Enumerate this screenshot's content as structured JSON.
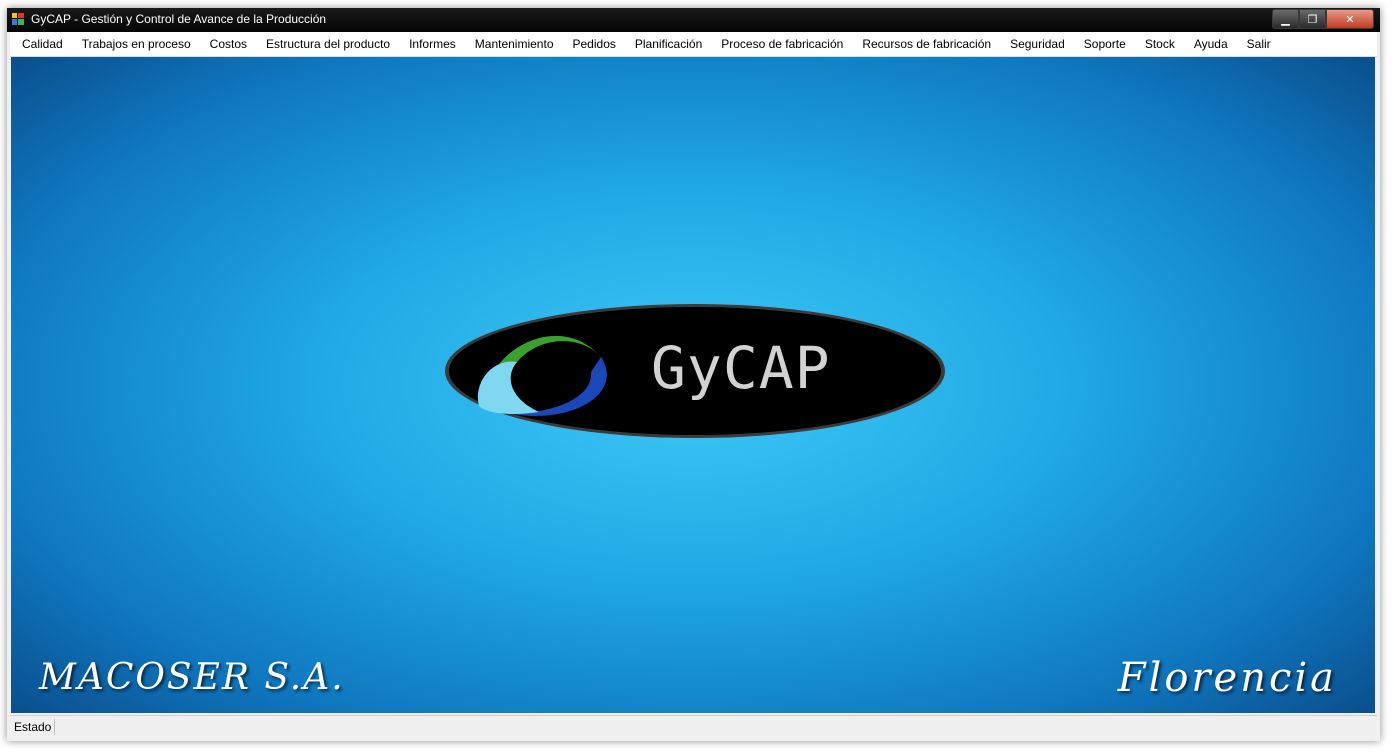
{
  "window": {
    "title": "GyCAP - Gestión y Control de Avance de la Producción",
    "icon": "app-window-icon",
    "controls": {
      "minimize": "▁",
      "maximize": "❐",
      "close": "✕"
    }
  },
  "menu": {
    "items": [
      {
        "label": "Calidad"
      },
      {
        "label": "Trabajos en proceso"
      },
      {
        "label": "Costos"
      },
      {
        "label": "Estructura del producto"
      },
      {
        "label": "Informes"
      },
      {
        "label": "Mantenimiento"
      },
      {
        "label": "Pedidos"
      },
      {
        "label": "Planificación"
      },
      {
        "label": "Proceso de fabricación"
      },
      {
        "label": "Recursos de fabricación"
      },
      {
        "label": "Seguridad"
      },
      {
        "label": "Soporte"
      },
      {
        "label": "Stock"
      },
      {
        "label": "Ayuda"
      },
      {
        "label": "Salir"
      }
    ]
  },
  "splash": {
    "logo_text": "GyCAP",
    "company": "MACOSER S.A.",
    "location": "Florencia"
  },
  "status": {
    "label": "Estado"
  },
  "colors": {
    "background_center": "#3ec8f6",
    "background_edge": "#0a4a88",
    "logo_green": "#3aa030",
    "logo_blue": "#1a48b8",
    "logo_cyan": "#7fd8f0"
  }
}
